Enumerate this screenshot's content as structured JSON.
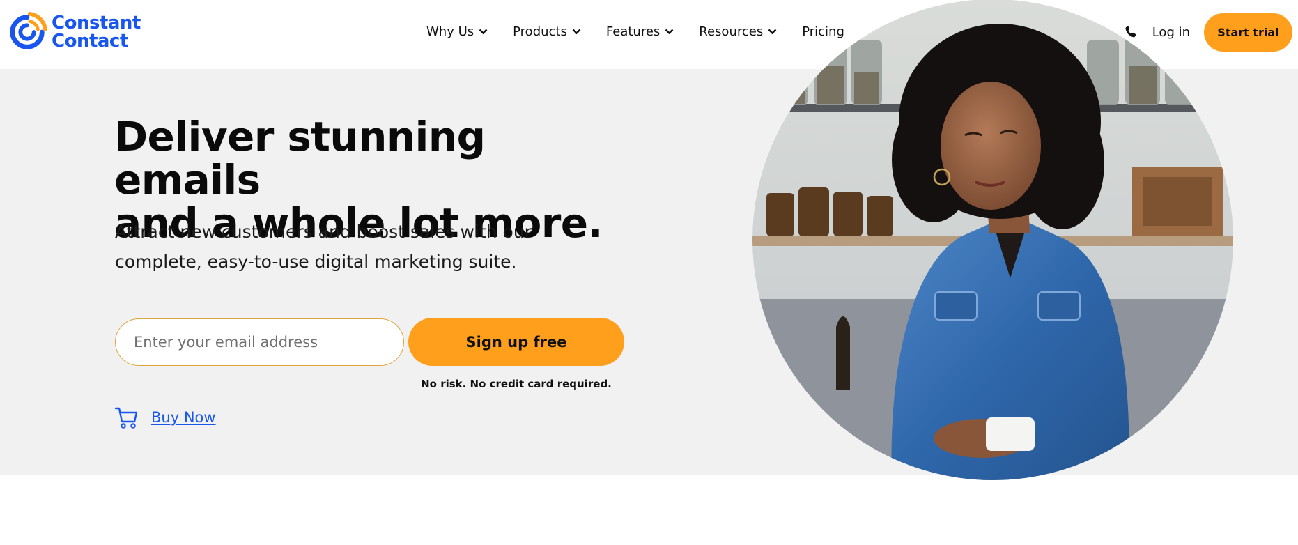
{
  "brand": {
    "name_line1": "Constant",
    "name_line2": "Contact",
    "color": "#1856ed",
    "accent": "#ff9f1c"
  },
  "nav": {
    "items": [
      {
        "label": "Why Us",
        "has_dropdown": true
      },
      {
        "label": "Products",
        "has_dropdown": true
      },
      {
        "label": "Features",
        "has_dropdown": true
      },
      {
        "label": "Resources",
        "has_dropdown": true
      },
      {
        "label": "Pricing",
        "has_dropdown": false
      }
    ],
    "login_label": "Log in",
    "start_trial_label": "Start trial",
    "phone_icon": "phone-icon"
  },
  "hero": {
    "headline_line1": "Deliver stunning emails",
    "headline_line2": "and a whole lot more.",
    "sub_line1": "Attract new customers and boost sales with our",
    "sub_line2": "complete, easy-to-use digital marketing suite.",
    "email_placeholder": "Enter your email address",
    "signup_label": "Sign up free",
    "no_risk_text": "No risk. No credit card required.",
    "buy_now_label": "Buy Now",
    "background": "#f1f1f1"
  }
}
